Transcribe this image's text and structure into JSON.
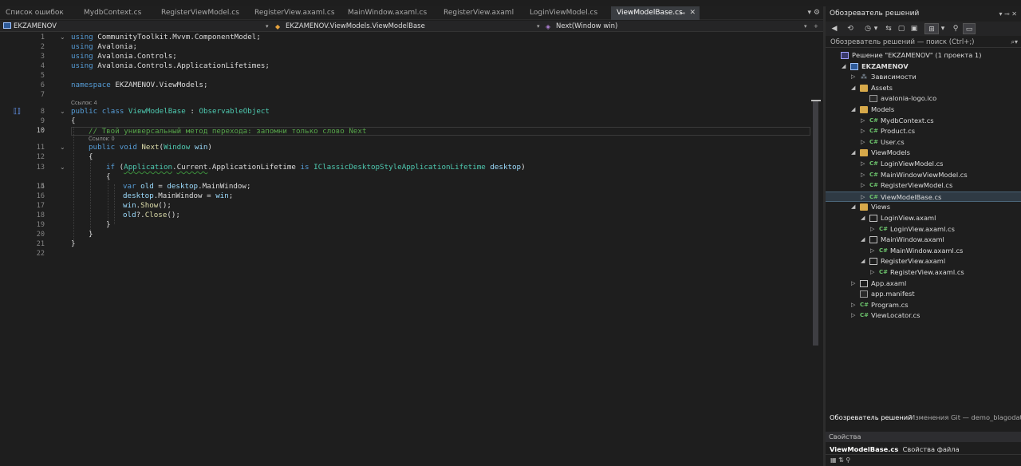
{
  "tabs": [
    {
      "label": "Список ошибок",
      "active": false
    },
    {
      "label": "MydbContext.cs",
      "active": false
    },
    {
      "label": "RegisterViewModel.cs",
      "active": false
    },
    {
      "label": "RegisterView.axaml.cs",
      "active": false
    },
    {
      "label": "MainWindow.axaml.cs",
      "active": false
    },
    {
      "label": "RegisterView.axaml",
      "active": false
    },
    {
      "label": "LoginViewModel.cs",
      "active": false
    },
    {
      "label": "ViewModelBase.cs",
      "active": true,
      "pin": "⊸",
      "close": "✕"
    }
  ],
  "tabbar_tools": "▾ ⚙",
  "navbar": {
    "project": "EKZAMENOV",
    "type": "EKZAMENOV.ViewModels.ViewModelBase",
    "member": "Next(Window win)"
  },
  "codelens": {
    "class_refs": "Ссылок: 4",
    "method_refs": "Ссылок: 0"
  },
  "code": {
    "l1_kw": "using",
    "l1_rest": " CommunityToolkit.Mvvm.ComponentModel;",
    "l2_kw": "using",
    "l2_rest": " Avalonia;",
    "l3_kw": "using",
    "l3_rest": " Avalonia.Controls;",
    "l4_kw": "using",
    "l4_rest": " Avalonia.Controls.ApplicationLifetimes;",
    "l6_kw": "namespace",
    "l6_rest": " EKZAMENOV.ViewModels;",
    "l8_kw": "public class",
    "l8_name": " ViewModelBase",
    "l8_colon": " : ",
    "l8_base": "ObservableObject",
    "l9": "{",
    "l10": "// Твой универсальный метод перехода: запомни только слово Next",
    "l11_kw": "public void",
    "l11_name": " Next",
    "l11_p1": "(",
    "l11_type": "Window",
    "l11_arg": " win",
    "l11_p2": ")",
    "l12": "{",
    "l13_kw": "if",
    "l13_p": " (",
    "l13_app": "Application",
    "l13_dot": ".",
    "l13_cur": "Current",
    "l13_rest": ".ApplicationLifetime ",
    "l13_is": "is",
    "l13_type": " IClassicDesktopStyleApplicationLifetime",
    "l13_var": " desktop",
    "l13_end": ")",
    "l14": "{",
    "l15_kw": "var",
    "l15_v": " old",
    "l15_eq": " = ",
    "l15_d": "desktop",
    "l15_rest": ".MainWindow;",
    "l16_d": "desktop",
    "l16_rest": ".MainWindow = ",
    "l16_w": "win",
    "l16_end": ";",
    "l17_w": "win",
    "l17_dot": ".",
    "l17_m": "Show",
    "l17_end": "();",
    "l18_o": "old",
    "l18_q": "?.",
    "l18_m": "Close",
    "l18_end": "();",
    "l19": "}",
    "l20": "}",
    "l21": "}"
  },
  "line_numbers": [
    "1",
    "2",
    "3",
    "4",
    "5",
    "6",
    "7",
    "8",
    "9",
    "10",
    "11",
    "12",
    "13",
    "14",
    "15",
    "16",
    "17",
    "18",
    "19",
    "20",
    "21",
    "22"
  ],
  "explorer": {
    "title": "Обозреватель решений",
    "title_btns": "▾ ⊸ ✕",
    "search": "Обозреватель решений — поиск (Ctrl+;)",
    "search_icon": "⌕▾",
    "toolbar": [
      "◀",
      "⟲",
      "◷",
      "▾",
      "⇆",
      "▢",
      "▣",
      "⊞",
      "▾",
      "⚲",
      "▭"
    ],
    "rows": [
      {
        "label": "Решение \"EKZAMENOV\" (1 проекта 1)",
        "icon": "sln",
        "arrow": "",
        "indent": 0
      },
      {
        "label": "EKZAMENOV",
        "icon": "proj",
        "arrow": "◢",
        "indent": 1,
        "bold": true
      },
      {
        "label": "Зависимости",
        "icon": "deps",
        "arrow": "▷",
        "indent": 2
      },
      {
        "label": "Assets",
        "icon": "folder",
        "arrow": "◢",
        "indent": 2
      },
      {
        "label": "avalonia-logo.ico",
        "icon": "file",
        "arrow": "",
        "indent": 3
      },
      {
        "label": "Models",
        "icon": "folder",
        "arrow": "◢",
        "indent": 2
      },
      {
        "label": "MydbContext.cs",
        "icon": "cs",
        "arrow": "▷",
        "indent": 3
      },
      {
        "label": "Product.cs",
        "icon": "cs",
        "arrow": "▷",
        "indent": 3
      },
      {
        "label": "User.cs",
        "icon": "cs",
        "arrow": "▷",
        "indent": 3
      },
      {
        "label": "ViewModels",
        "icon": "folder",
        "arrow": "◢",
        "indent": 2
      },
      {
        "label": "LoginViewModel.cs",
        "icon": "cs",
        "arrow": "▷",
        "indent": 3
      },
      {
        "label": "MainWindowViewModel.cs",
        "icon": "cs",
        "arrow": "▷",
        "indent": 3
      },
      {
        "label": "RegisterViewModel.cs",
        "icon": "cs",
        "arrow": "▷",
        "indent": 3
      },
      {
        "label": "ViewModelBase.cs",
        "icon": "cs",
        "arrow": "▷",
        "indent": 3,
        "selected": true
      },
      {
        "label": "Views",
        "icon": "folder",
        "arrow": "◢",
        "indent": 2
      },
      {
        "label": "LoginView.axaml",
        "icon": "xaml",
        "arrow": "◢",
        "indent": 3
      },
      {
        "label": "LoginView.axaml.cs",
        "icon": "cs",
        "arrow": "▷",
        "indent": 4
      },
      {
        "label": "MainWindow.axaml",
        "icon": "xaml",
        "arrow": "◢",
        "indent": 3
      },
      {
        "label": "MainWindow.axaml.cs",
        "icon": "cs",
        "arrow": "▷",
        "indent": 4
      },
      {
        "label": "RegisterView.axaml",
        "icon": "xaml",
        "arrow": "◢",
        "indent": 3
      },
      {
        "label": "RegisterView.axaml.cs",
        "icon": "cs",
        "arrow": "▷",
        "indent": 4
      },
      {
        "label": "App.axaml",
        "icon": "xaml",
        "arrow": "▷",
        "indent": 2
      },
      {
        "label": "app.manifest",
        "icon": "file",
        "arrow": "",
        "indent": 2
      },
      {
        "label": "Program.cs",
        "icon": "cs",
        "arrow": "▷",
        "indent": 2
      },
      {
        "label": "ViewLocator.cs",
        "icon": "cs",
        "arrow": "▷",
        "indent": 2
      }
    ],
    "bottom_tabs": [
      "Обозреватель решений",
      "Изменения Git — demo_blagodat"
    ]
  },
  "properties": {
    "title": "Свойства",
    "object": "ViewModelBase.cs",
    "object_kind": "Свойства файла",
    "tools": "▦ ⇅ ⚲"
  },
  "icons": {
    "cs": "C#",
    "bookmark": "⟦⟧",
    "caret": "▾",
    "fold": "⌄"
  },
  "colors": {
    "keyword": "#569cd6",
    "type": "#4ec9b0",
    "comment": "#57a64a",
    "method": "#dcdcaa",
    "variable": "#9cdcfe",
    "selection": "#2f3a44"
  }
}
